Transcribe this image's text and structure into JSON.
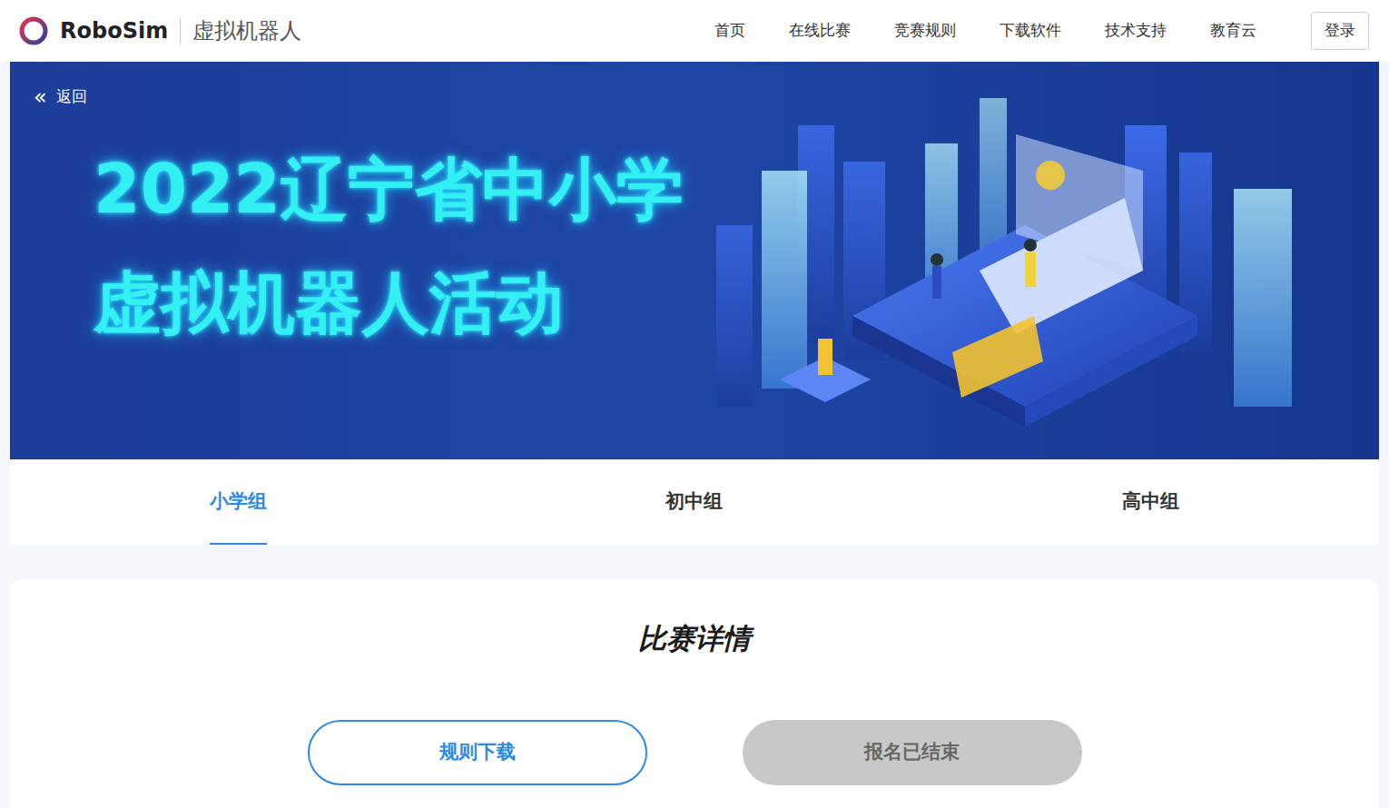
{
  "header": {
    "logo": "RoboSim",
    "subtitle": "虚拟机器人",
    "nav": [
      "首页",
      "在线比赛",
      "竞赛规则",
      "下载软件",
      "技术支持",
      "教育云"
    ],
    "login": "登录"
  },
  "banner": {
    "back_icon": "«",
    "back": "返回",
    "title_lines": [
      "2022辽宁省中小学",
      "虚拟机器人活动"
    ]
  },
  "tabs": [
    {
      "label": "小学组",
      "selected": true
    },
    {
      "label": "初中组",
      "selected": false
    },
    {
      "label": "高中组",
      "selected": false
    }
  ],
  "details": {
    "title": "比赛详情",
    "buttons": [
      {
        "label": "规则下载",
        "disabled": false
      },
      {
        "label": "报名已结束",
        "disabled": true
      }
    ]
  }
}
